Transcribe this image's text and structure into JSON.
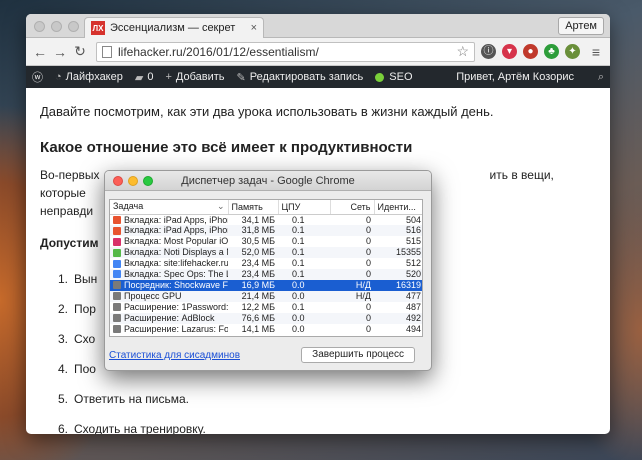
{
  "browser": {
    "tab": {
      "favicon": "ЛХ",
      "title": "Эссенциализм — секрет",
      "close": "×"
    },
    "profile_button": "Артем",
    "url": "lifehacker.ru/2016/01/12/essentialism/",
    "nav_back": "←",
    "nav_forward": "→",
    "nav_reload": "↻",
    "menu": "≡",
    "extensions": [
      {
        "icon": "info-icon",
        "glyph": "ⓘ",
        "color": "#555555"
      },
      {
        "icon": "pocket-icon",
        "glyph": "▾",
        "color": "#d6334a"
      },
      {
        "icon": "car-icon",
        "glyph": "●",
        "color": "#c0392b"
      },
      {
        "icon": "evernote-icon",
        "glyph": "♣",
        "color": "#2d9d3a"
      },
      {
        "icon": "puzzle-icon",
        "glyph": "✦",
        "color": "#6a8f3a"
      }
    ]
  },
  "adminbar": {
    "site": "Лайфхакер",
    "comments": "0",
    "add": "Добавить",
    "edit": "Редактировать запись",
    "seo": "SEO",
    "greeting": "Привет, Артём Козорис"
  },
  "article": {
    "lead": "Давайте посмотрим, как эти два урока использовать в жизни каждый день.",
    "heading": "Какое отношение это всё имеет к продуктивности",
    "para_start": "Во-первых",
    "para_mid": "ить в вещи, которые",
    "para_line2": "неправди",
    "bold_start": "Допустим",
    "steps": [
      {
        "num": "1.",
        "text": "Вын"
      },
      {
        "num": "2.",
        "text": "Пор"
      },
      {
        "num": "3.",
        "text": "Схо"
      },
      {
        "num": "4.",
        "text": "Поо"
      },
      {
        "num": "5.",
        "text": "Ответить на письма."
      },
      {
        "num": "6.",
        "text": "Сходить на тренировку."
      }
    ]
  },
  "task_manager": {
    "title": "Диспетчер задач - Google Chrome",
    "columns": [
      "Задача",
      "Память",
      "ЦПУ",
      "Сеть",
      "Иденти..."
    ],
    "rows": [
      {
        "task": "Вкладка: iPad Apps, iPhon",
        "mem": "34,1 МБ",
        "cpu": "0.1",
        "net": "0",
        "id": "504",
        "icon_color": "#e8532f"
      },
      {
        "task": "Вкладка: iPad Apps, iPhon",
        "mem": "31,8 МБ",
        "cpu": "0.1",
        "net": "0",
        "id": "516",
        "icon_color": "#e8532f"
      },
      {
        "task": "Вкладка: Most Popular iOS",
        "mem": "30,5 МБ",
        "cpu": "0.1",
        "net": "0",
        "id": "515",
        "icon_color": "#d9306a"
      },
      {
        "task": "Вкладка: Noti Displays a N",
        "mem": "52,0 МБ",
        "cpu": "0.1",
        "net": "0",
        "id": "15355",
        "icon_color": "#55b948"
      },
      {
        "task": "Вкладка: site:lifehacker.ru",
        "mem": "23,4 МБ",
        "cpu": "0.1",
        "net": "0",
        "id": "512",
        "icon_color": "#4285f4"
      },
      {
        "task": "Вкладка: Spec Ops: The L",
        "mem": "23,4 МБ",
        "cpu": "0.1",
        "net": "0",
        "id": "520",
        "icon_color": "#4285f4"
      },
      {
        "task": "Посредник: Shockwave Fl",
        "mem": "16,9 МБ",
        "cpu": "0.0",
        "net": "Н/Д",
        "id": "16319",
        "icon_color": "#7a7a7a",
        "selected": true
      },
      {
        "task": "Процесс GPU",
        "mem": "21,4 МБ",
        "cpu": "0.0",
        "net": "Н/Д",
        "id": "477",
        "icon_color": "#7a7a7a"
      },
      {
        "task": "Расширение: 1Password:",
        "mem": "12,2 МБ",
        "cpu": "0.1",
        "net": "0",
        "id": "487",
        "icon_color": "#7a7a7a"
      },
      {
        "task": "Расширение: AdBlock",
        "mem": "76,6 МБ",
        "cpu": "0.0",
        "net": "0",
        "id": "492",
        "icon_color": "#7a7a7a"
      },
      {
        "task": "Расширение: Lazarus: For",
        "mem": "14,1 МБ",
        "cpu": "0.0",
        "net": "0",
        "id": "494",
        "icon_color": "#7a7a7a"
      }
    ],
    "stats_link": "Статистика для сисадминов",
    "end_button": "Завершить процесс"
  }
}
